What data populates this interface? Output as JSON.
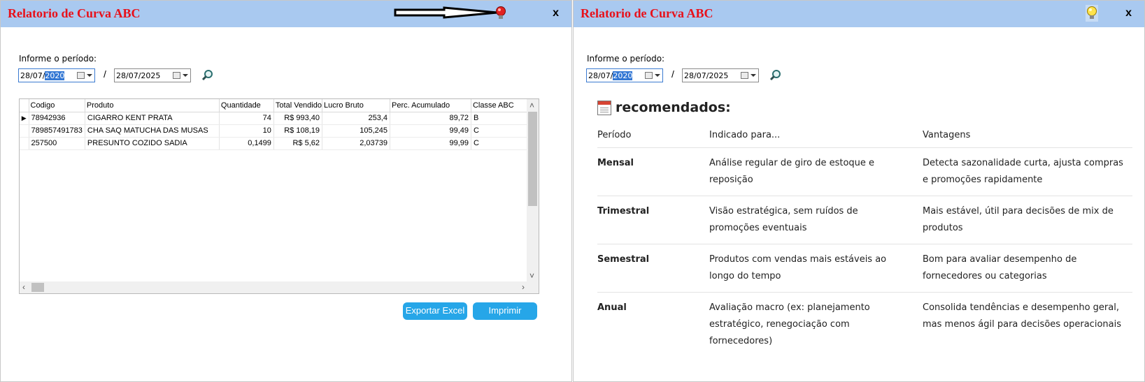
{
  "left_window": {
    "title": "Relatorio de Curva ABC",
    "close_label": "x",
    "period_label": "Informe o período:",
    "date_from": {
      "prefix": "28/07/",
      "selected": "2020"
    },
    "date_to": "28/07/2025",
    "separator": "/",
    "grid": {
      "columns": [
        "Codigo",
        "Produto",
        "Quantidade",
        "Total Vendido",
        "Lucro Bruto",
        "Perc. Acumulado",
        "Classe ABC"
      ],
      "rows": [
        [
          "78942936",
          "CIGARRO KENT PRATA",
          "74",
          "R$ 993,40",
          "253,4",
          "89,72",
          "B"
        ],
        [
          "789857491783",
          "CHA SAQ MATUCHA DAS MUSAS",
          "10",
          "R$ 108,19",
          "105,245",
          "99,49",
          "C"
        ],
        [
          "257500",
          "PRESUNTO COZIDO SADIA",
          "0,1499",
          "R$ 5,62",
          "2,03739",
          "99,99",
          "C"
        ]
      ]
    },
    "export_label": "Exportar Excel",
    "print_label": "Imprimir"
  },
  "right_window": {
    "title": "Relatorio de Curva ABC",
    "close_label": "x",
    "period_label": "Informe o período:",
    "date_from": {
      "prefix": "28/07/",
      "selected": "2020"
    },
    "date_to": "28/07/2025",
    "separator": "/",
    "recommendations": {
      "heading": "recomendados:",
      "headers": [
        "Período",
        "Indicado para...",
        "Vantagens"
      ],
      "rows": [
        {
          "period": "Mensal",
          "indicated": "Análise regular de giro de estoque e reposição",
          "advantages": "Detecta sazonalidade curta, ajusta compras e promoções rapidamente"
        },
        {
          "period": "Trimestral",
          "indicated": "Visão estratégica, sem ruídos de promoções eventuais",
          "advantages": "Mais estável, útil para decisões de mix de produtos"
        },
        {
          "period": "Semestral",
          "indicated": "Produtos com vendas mais estáveis ao longo do tempo",
          "advantages": "Bom para avaliar desempenho de fornecedores ou categorias"
        },
        {
          "period": "Anual",
          "indicated": "Avaliação macro (ex: planejamento estratégico, renegociação com fornecedores)",
          "advantages": "Consolida tendências e desempenho geral, mas menos ágil para decisões operacionais"
        }
      ]
    }
  },
  "colors": {
    "titlebar": "#a9c9f0",
    "title_text": "#e8101a",
    "button": "#26a6e8",
    "selection": "#3478d4"
  },
  "icons": [
    "red-lightbulb-icon",
    "yellow-lightbulb-icon",
    "arrow-annotation-icon",
    "magnifier-search-icon",
    "calendar-icon",
    "chevron-down-icon"
  ]
}
